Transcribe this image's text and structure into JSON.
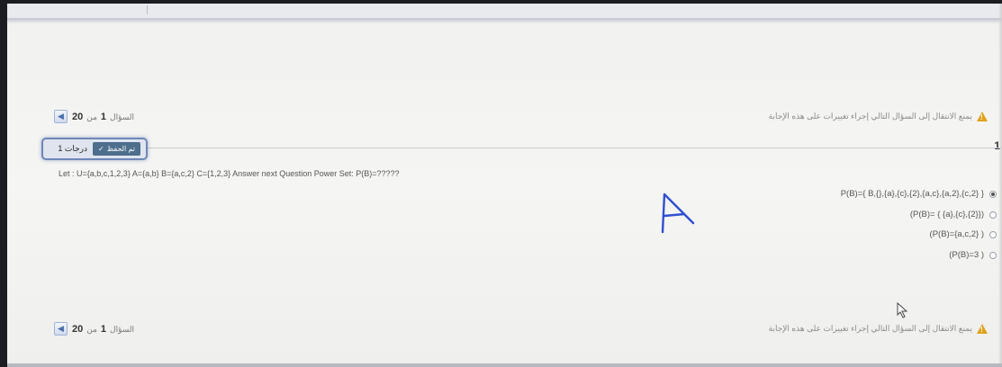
{
  "nav": {
    "question_label": "السؤال",
    "current": "1",
    "of_label": "من",
    "total": "20",
    "prev_icon": "chevron-left-icon",
    "warning_text": "يمنع الانتقال إلى السؤال التالي إجراء تغييرات على هذه الإجابة",
    "warning_icon": "warning-icon",
    "warning_color": "#e0a21a"
  },
  "question": {
    "number_label": "1",
    "grade_text": "1 درجات",
    "saved_label": "تم الحفظ",
    "saved_icon": "check-icon",
    "text": "Let : U={a,b,c,1,2,3} A={a,b} B={a,c,2} C={1,2,3} Answer next Question Power Set: P(B)=?????",
    "answers": [
      {
        "label": "P(B)={ B,{},{a},{c},{2},{a,c},{a,2},{c,2} }",
        "checked": true
      },
      {
        "label": "(P(B)= { {a},{c},{2}})",
        "checked": false
      },
      {
        "label": "(P(B)={a,c,2} )",
        "checked": false
      },
      {
        "label": "(P(B)=3 )",
        "checked": false
      }
    ]
  },
  "annotation": {
    "handwritten_mark": "A",
    "mark_color": "#2f4fd0"
  }
}
